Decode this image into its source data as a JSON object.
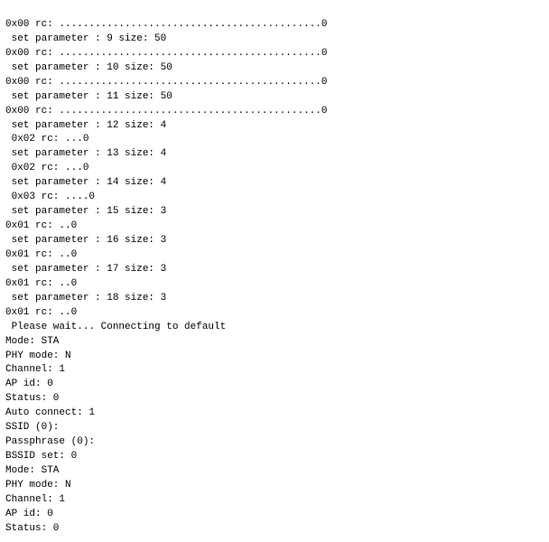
{
  "terminal": {
    "lines": [
      "0x00 rc: ............................................0",
      " set parameter : 9 size: 50",
      "0x00 rc: ............................................0",
      " set parameter : 10 size: 50",
      "0x00 rc: ............................................0",
      " set parameter : 11 size: 50",
      "0x00 rc: ............................................0",
      " set parameter : 12 size: 4",
      " 0x02 rc: ...0",
      " set parameter : 13 size: 4",
      " 0x02 rc: ...0",
      " set parameter : 14 size: 4",
      " 0x03 rc: ....0",
      " set parameter : 15 size: 3",
      "0x01 rc: ..0",
      " set parameter : 16 size: 3",
      "0x01 rc: ..0",
      " set parameter : 17 size: 3",
      "0x01 rc: ..0",
      " set parameter : 18 size: 3",
      "0x01 rc: ..0",
      "",
      " Please wait... Connecting to default",
      "Mode: STA",
      "PHY mode: N",
      "Channel: 1",
      "AP id: 0",
      "Status: 0",
      "Auto connect: 1",
      "SSID (0):",
      "Passphrase (0):",
      "BSSID set: 0",
      "Mode: STA",
      "PHY mode: N",
      "Channel: 1",
      "AP id: 0",
      "Status: 0"
    ]
  }
}
